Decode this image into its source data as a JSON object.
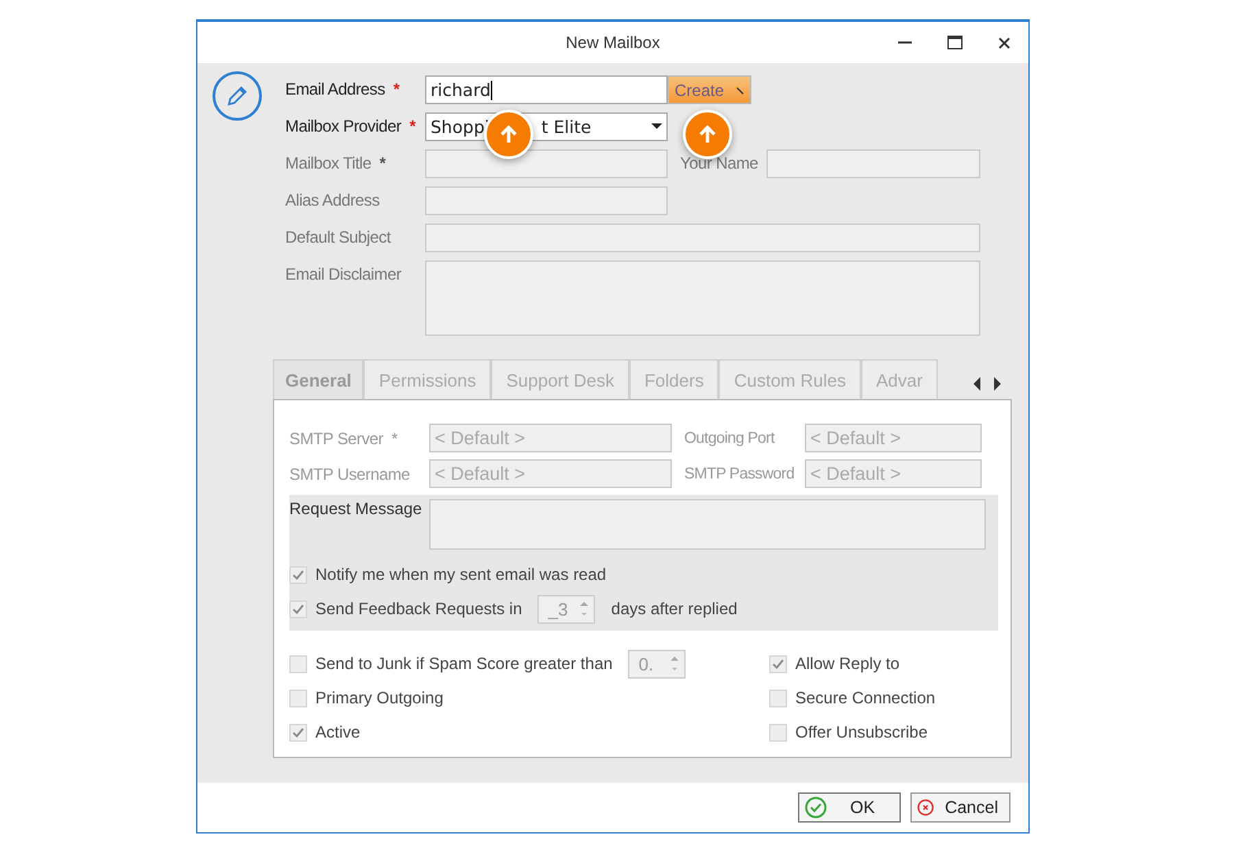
{
  "window": {
    "title": "New Mailbox"
  },
  "form": {
    "rows": [
      [
        {
          "kind": "text",
          "label": "Email Address",
          "mark": "*",
          "disabled": false,
          "value": "richard",
          "focused": true,
          "button": "Create"
        }
      ],
      [
        {
          "kind": "select",
          "label": "Mailbox Provider",
          "mark": "*",
          "disabled": false,
          "value_parts": [
            "Shoppi",
            "t Elite"
          ]
        }
      ],
      [
        {
          "kind": "text",
          "label": "Mailbox Title",
          "mark": "*",
          "disabled": true
        },
        {
          "kind": "text",
          "label": "Your Name",
          "disabled": true
        }
      ],
      [
        {
          "kind": "text",
          "label": "Alias Address",
          "disabled": true
        }
      ],
      [
        {
          "kind": "wide",
          "label": "Default Subject",
          "disabled": true
        }
      ],
      [
        {
          "kind": "area",
          "label": "Email Disclaimer",
          "disabled": true
        }
      ]
    ]
  },
  "tabs": [
    {
      "label": "General",
      "selected": true
    },
    {
      "label": "Permissions",
      "selected": false
    },
    {
      "label": "Support Desk",
      "selected": false
    },
    {
      "label": "Folders",
      "selected": false
    },
    {
      "label": "Custom Rules",
      "selected": false
    },
    {
      "label": "Advar",
      "selected": false
    }
  ],
  "general": {
    "server_rows": [
      [
        {
          "label": "SMTP Server",
          "mark": "*",
          "placeholder": "< Default >"
        },
        {
          "label": "Outgoing Port",
          "placeholder": "< Default >"
        }
      ],
      [
        {
          "label": "SMTP Username",
          "placeholder": "< Default >"
        },
        {
          "label": "SMTP Password",
          "placeholder": "< Default >"
        }
      ]
    ],
    "request": {
      "label": "Request Message",
      "options": [
        {
          "label": "Notify me when my sent email was read",
          "checked": true
        },
        {
          "label": "Send Feedback Requests in",
          "checked": true,
          "spin": "_3",
          "after": "days after replied"
        }
      ]
    },
    "left_options": [
      {
        "label": "Send to Junk if Spam Score greater than",
        "checked": false,
        "spin": "0."
      },
      {
        "label": "Primary Outgoing",
        "checked": false
      },
      {
        "label": "Active",
        "checked": true
      }
    ],
    "right_options": [
      {
        "label": "Allow Reply to",
        "checked": true
      },
      {
        "label": "Secure Connection",
        "checked": false
      },
      {
        "label": "Offer Unsubscribe",
        "checked": false
      }
    ]
  },
  "buttons": [
    {
      "kind": "ok",
      "label": "OK"
    },
    {
      "kind": "cancel",
      "label": "Cancel"
    }
  ]
}
